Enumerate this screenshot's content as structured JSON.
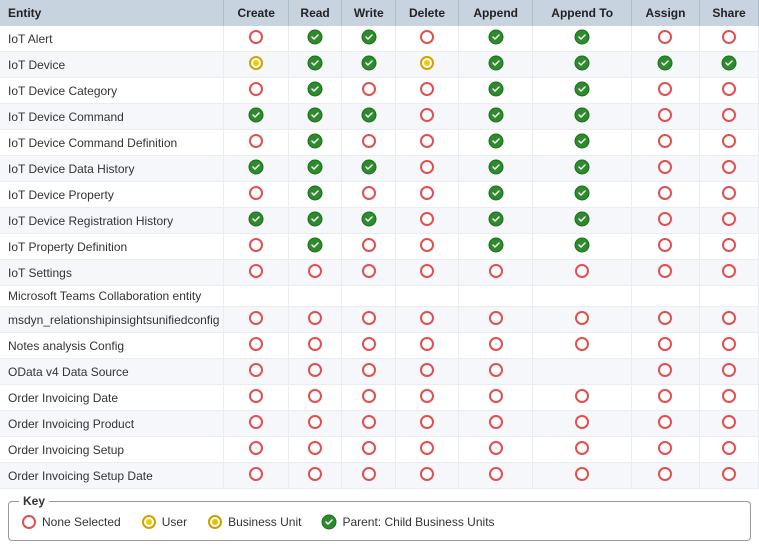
{
  "header": {
    "columns": [
      "Entity",
      "Create",
      "Read",
      "Write",
      "Delete",
      "Append",
      "Append To",
      "Assign",
      "Share"
    ]
  },
  "rows": [
    {
      "entity": "IoT Alert",
      "create": "none",
      "read": "parent",
      "write": "parent",
      "delete": "none",
      "append": "parent",
      "appendTo": "parent",
      "assign": "none",
      "share": "none"
    },
    {
      "entity": "IoT Device",
      "create": "user",
      "read": "parent",
      "write": "parent",
      "delete": "user",
      "append": "parent",
      "appendTo": "parent",
      "assign": "parent",
      "share": "parent"
    },
    {
      "entity": "IoT Device Category",
      "create": "none",
      "read": "parent",
      "write": "none",
      "delete": "none",
      "append": "parent",
      "appendTo": "parent",
      "assign": "none",
      "share": "none"
    },
    {
      "entity": "IoT Device Command",
      "create": "parent",
      "read": "parent",
      "write": "parent",
      "delete": "none",
      "append": "parent",
      "appendTo": "parent",
      "assign": "none",
      "share": "none"
    },
    {
      "entity": "IoT Device Command Definition",
      "create": "none",
      "read": "parent",
      "write": "none",
      "delete": "none",
      "append": "parent",
      "appendTo": "parent",
      "assign": "none",
      "share": "none"
    },
    {
      "entity": "IoT Device Data History",
      "create": "parent",
      "read": "parent",
      "write": "parent",
      "delete": "none",
      "append": "parent",
      "appendTo": "parent",
      "assign": "none",
      "share": "none"
    },
    {
      "entity": "IoT Device Property",
      "create": "none",
      "read": "parent",
      "write": "none",
      "delete": "none",
      "append": "parent",
      "appendTo": "parent",
      "assign": "none",
      "share": "none"
    },
    {
      "entity": "IoT Device Registration History",
      "create": "parent",
      "read": "parent",
      "write": "parent",
      "delete": "none",
      "append": "parent",
      "appendTo": "parent",
      "assign": "none",
      "share": "none"
    },
    {
      "entity": "IoT Property Definition",
      "create": "none",
      "read": "parent",
      "write": "none",
      "delete": "none",
      "append": "parent",
      "appendTo": "parent",
      "assign": "none",
      "share": "none"
    },
    {
      "entity": "IoT Settings",
      "create": "none",
      "read": "none",
      "write": "none",
      "delete": "none",
      "append": "none",
      "appendTo": "none",
      "assign": "none",
      "share": "none"
    },
    {
      "entity": "Microsoft Teams Collaboration entity",
      "create": "",
      "read": "",
      "write": "",
      "delete": "",
      "append": "",
      "appendTo": "",
      "assign": "",
      "share": ""
    },
    {
      "entity": "msdyn_relationshipinsightsunifiedconfig",
      "create": "none",
      "read": "none",
      "write": "none",
      "delete": "none",
      "append": "none",
      "appendTo": "none",
      "assign": "none",
      "share": "none"
    },
    {
      "entity": "Notes analysis Config",
      "create": "none",
      "read": "none",
      "write": "none",
      "delete": "none",
      "append": "none",
      "appendTo": "none",
      "assign": "none",
      "share": "none"
    },
    {
      "entity": "OData v4 Data Source",
      "create": "none",
      "read": "none",
      "write": "none",
      "delete": "none",
      "append": "none",
      "appendTo": "",
      "assign": "none",
      "share": "none"
    },
    {
      "entity": "Order Invoicing Date",
      "create": "none",
      "read": "none",
      "write": "none",
      "delete": "none",
      "append": "none",
      "appendTo": "none",
      "assign": "none",
      "share": "none"
    },
    {
      "entity": "Order Invoicing Product",
      "create": "none",
      "read": "none",
      "write": "none",
      "delete": "none",
      "append": "none",
      "appendTo": "none",
      "assign": "none",
      "share": "none"
    },
    {
      "entity": "Order Invoicing Setup",
      "create": "none",
      "read": "none",
      "write": "none",
      "delete": "none",
      "append": "none",
      "appendTo": "none",
      "assign": "none",
      "share": "none"
    },
    {
      "entity": "Order Invoicing Setup Date",
      "create": "none",
      "read": "none",
      "write": "none",
      "delete": "none",
      "append": "none",
      "appendTo": "none",
      "assign": "none",
      "share": "none"
    }
  ],
  "key": {
    "title": "Key",
    "items": [
      {
        "label": "None Selected",
        "type": "none"
      },
      {
        "label": "User",
        "type": "user"
      },
      {
        "label": "Business Unit",
        "type": "business"
      },
      {
        "label": "Parent: Child Business Units",
        "type": "parent"
      }
    ]
  }
}
